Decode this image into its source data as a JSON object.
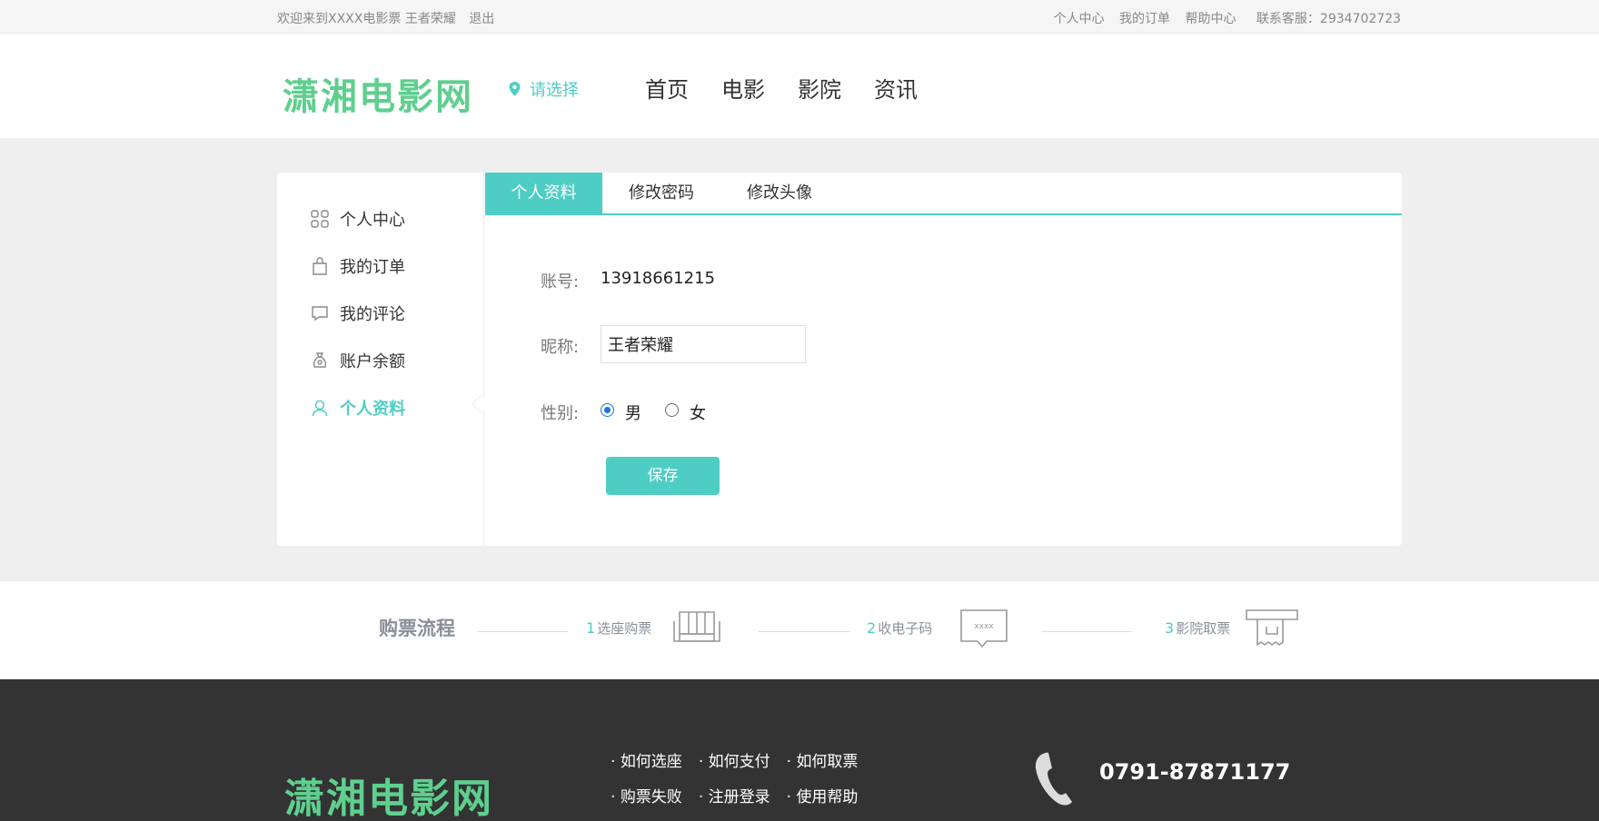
{
  "topbar": {
    "welcome": "欢迎来到XXXX电影票 王者荣耀",
    "logout": "退出",
    "user_center": "个人中心",
    "my_orders": "我的订单",
    "help": "帮助中心",
    "service": "联系客服：2934702723"
  },
  "header": {
    "logo": "潇湘电影网",
    "city": "请选择",
    "nav": [
      "首页",
      "电影",
      "影院",
      "资讯"
    ]
  },
  "sidebar": {
    "items": [
      {
        "label": "个人中心",
        "icon": "grid-icon"
      },
      {
        "label": "我的订单",
        "icon": "bag-icon"
      },
      {
        "label": "我的评论",
        "icon": "comment-icon"
      },
      {
        "label": "账户余额",
        "icon": "money-bag-icon"
      },
      {
        "label": "个人资料",
        "icon": "user-icon",
        "active": true
      }
    ]
  },
  "tabs": [
    "个人资料",
    "修改密码",
    "修改头像"
  ],
  "form": {
    "account_label": "账号:",
    "account_value": "13918661215",
    "nickname_label": "昵称:",
    "nickname_value": "王者荣耀",
    "gender_label": "性别:",
    "male": "男",
    "female": "女",
    "selected_gender": "男",
    "save": "保存"
  },
  "process": {
    "title": "购票流程",
    "steps": [
      {
        "num": "1",
        "label": "选座购票"
      },
      {
        "num": "2",
        "label": "收电子码"
      },
      {
        "num": "3",
        "label": "影院取票"
      }
    ],
    "code_text": "xxxx"
  },
  "footer": {
    "logo": "潇湘电影网",
    "links": [
      "如何选座",
      "如何支付",
      "如何取票",
      "购票失败",
      "注册登录",
      "使用帮助"
    ],
    "phone": "0791-87871177"
  },
  "colors": {
    "accent": "#4ecdc4",
    "logo_green": "#5fcf8e",
    "footer_bg": "#333333",
    "radio_blue": "#1a73e8"
  }
}
